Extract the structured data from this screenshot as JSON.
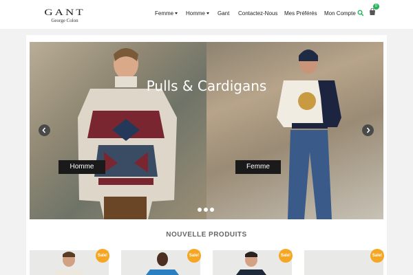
{
  "header": {
    "logo": {
      "brand": "GANT",
      "sub": "George Colon"
    },
    "nav": [
      {
        "label": "Femme",
        "dropdown": true
      },
      {
        "label": "Homme",
        "dropdown": true
      },
      {
        "label": "Gant",
        "dropdown": false
      },
      {
        "label": "Contactez-Nous",
        "dropdown": false
      },
      {
        "label": "Mes Préférés",
        "dropdown": false
      },
      {
        "label": "Mon Compte",
        "dropdown": false
      }
    ],
    "cart_count": "0",
    "icons": {
      "search": "search-icon",
      "cart": "cart-icon"
    }
  },
  "slider": {
    "title": "Pulls & Cardigans",
    "left_button": "Homme",
    "right_button": "Femme",
    "dots": 3,
    "active_dot": 1
  },
  "section": {
    "title": "NOUVELLE PRODUITS"
  },
  "products": [
    {
      "badge": "Sale!"
    },
    {
      "badge": "Sale!"
    },
    {
      "badge": "Sale!"
    },
    {
      "badge": "Sale!"
    }
  ],
  "colors": {
    "accent_green": "#26b35a",
    "sale_orange": "#f5a623",
    "dark_button": "#1a1a1a"
  }
}
